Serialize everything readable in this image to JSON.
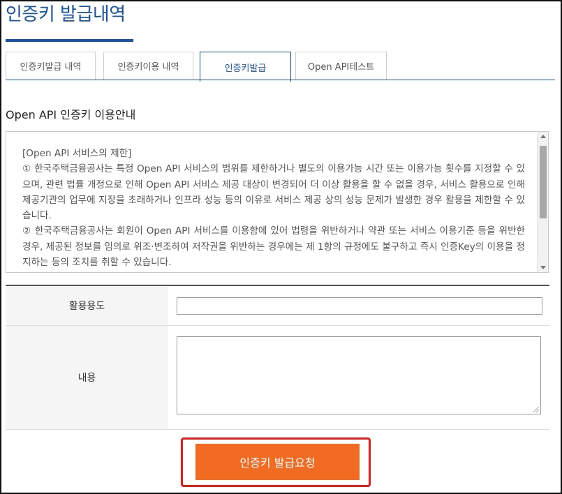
{
  "page": {
    "title": "인증키 발급내역"
  },
  "tabs": [
    {
      "label": "인증키발급 내역",
      "active": false
    },
    {
      "label": "인증키이용 내역",
      "active": false
    },
    {
      "label": "인증키발급",
      "active": true
    },
    {
      "label": "Open API테스트",
      "active": false
    }
  ],
  "notice": {
    "heading": "Open API 인증키 이용안내",
    "paragraphs": [
      "[Open API 서비스의 제한]",
      "① 한국주택금융공사는 특정 Open API 서비스의 범위를 제한하거나 별도의 이용가능 시간 또는 이용가능 횟수를 지정할 수 있으며, 관련 법률 개정으로 인해 Open API 서비스 제공 대상이 변경되어 더 이상 활용을 할 수 없을 경우, 서비스 활용으로 인해 제공기관의 업무에 지장을 초래하거나 인프라 성능 등의 이유로 서비스 제공 상의 성능 문제가 발생한 경우 활용을 제한할 수 있습니다.",
      "② 한국주택금융공사는 회원이 Open API 서비스를 이용함에 있어 법령을 위반하거나 약관 또는 서비스 이용기준 등을 위반한 경우, 제공된 정보를 임의로 위조·변조하여 저작권을 위반하는 경우에는 제 1항의 규정에도 불구하고 즉시 인증Key의 이용을 정지하는 등의 조치를 취할 수 있습니다."
    ]
  },
  "form": {
    "usage_label": "활용용도",
    "usage_value": "",
    "content_label": "내용",
    "content_value": ""
  },
  "actions": {
    "submit_label": "인증키 발급요청"
  },
  "colors": {
    "accent": "#1a55a3",
    "button": "#f26b22",
    "highlight": "#e81b1b"
  }
}
